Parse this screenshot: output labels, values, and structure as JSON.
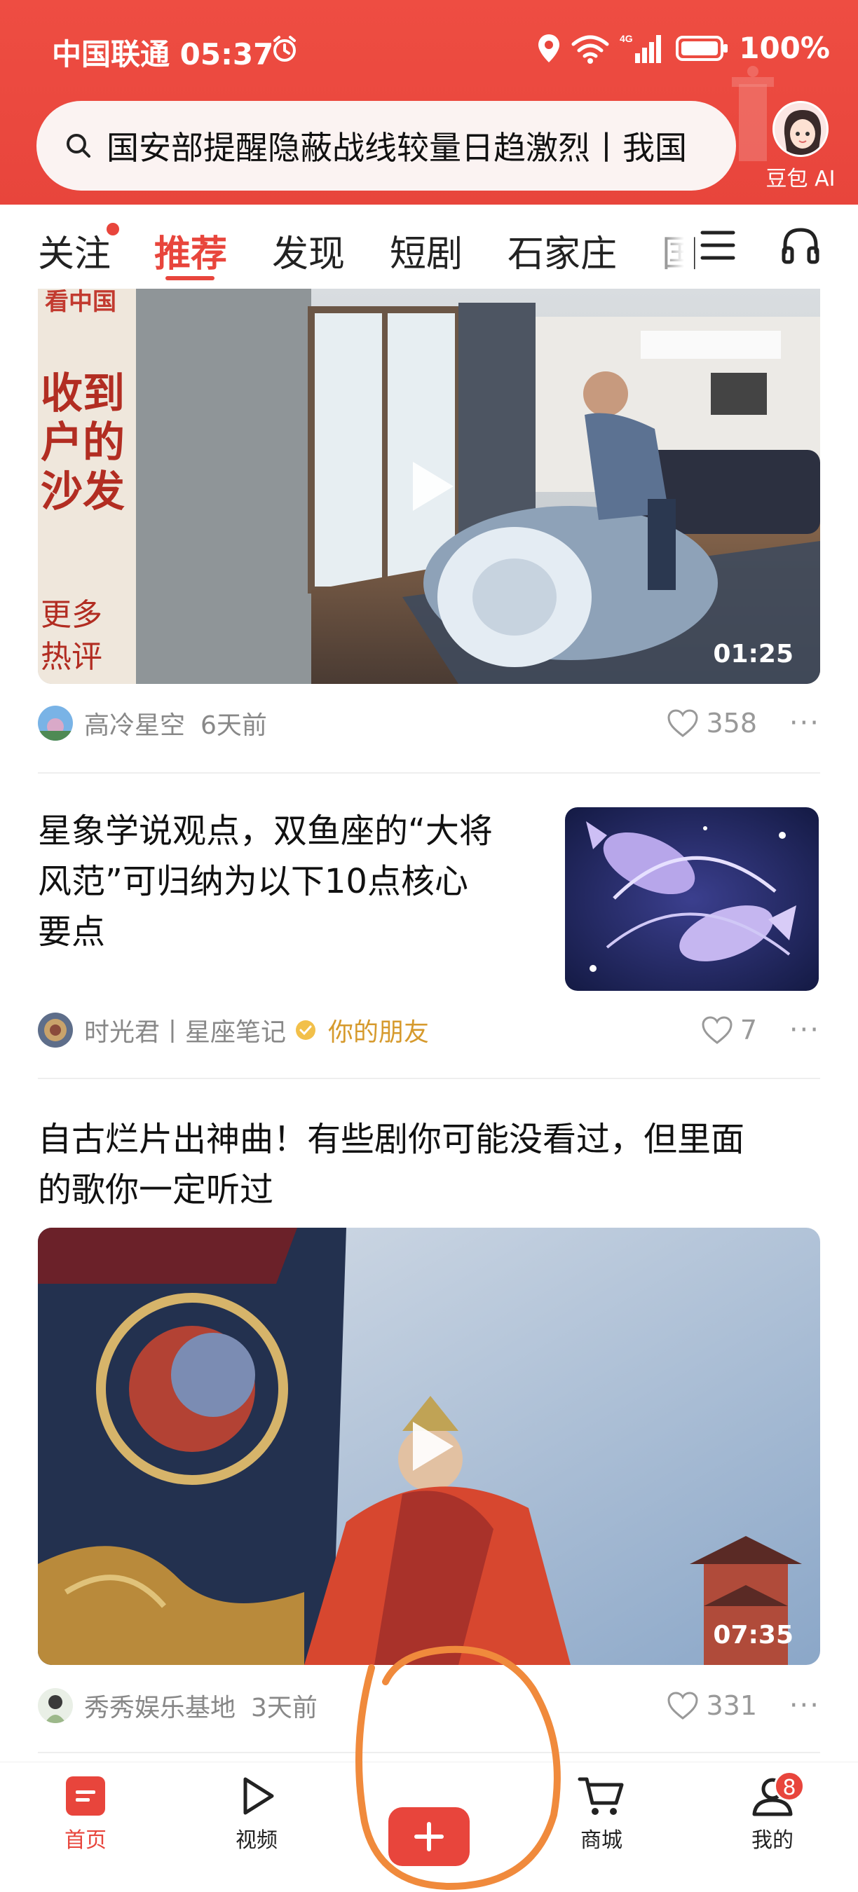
{
  "status_bar": {
    "carrier_time": "中国联通 05:37",
    "network": "4G",
    "battery": "100%"
  },
  "search": {
    "text": "国安部提醒隐蔽战线较量日趋激烈丨我国"
  },
  "ai_assistant": {
    "label": "豆包 AI"
  },
  "tabs": [
    {
      "label": "关注"
    },
    {
      "label": "推荐"
    },
    {
      "label": "发现"
    },
    {
      "label": "短剧"
    },
    {
      "label": "石家庄"
    },
    {
      "label": "国"
    }
  ],
  "feed": {
    "card1": {
      "overlay_text": [
        "看中国",
        "收到",
        "户的",
        "沙发",
        "更多",
        "热评"
      ],
      "duration": "01:25",
      "author": "高冷星空",
      "time": "6天前",
      "likes": "358"
    },
    "card2": {
      "title": "星象学说观点，双鱼座的“大将风范”可归纳为以下10点核心要点",
      "title_lines": [
        "星象学说观点，双鱼座的“大将",
        "风范”可归纳为以下10点核心",
        "要点"
      ],
      "author": "时光君丨星座笔记",
      "relation": "你的朋友",
      "likes": "7"
    },
    "card3": {
      "title_lines": [
        "自古烂片出神曲！有些剧你可能没看过，但里面",
        "的歌你一定听过"
      ],
      "duration": "07:35",
      "author": "秀秀娱乐基地",
      "time": "3天前",
      "likes": "331"
    }
  },
  "bottom_nav": {
    "home": "首页",
    "video": "视频",
    "mall": "商城",
    "mine": "我的",
    "mine_badge": "8"
  },
  "colors": {
    "brand": "#e8453c",
    "friend": "#d69a2d",
    "annotation": "#f08a3c"
  }
}
